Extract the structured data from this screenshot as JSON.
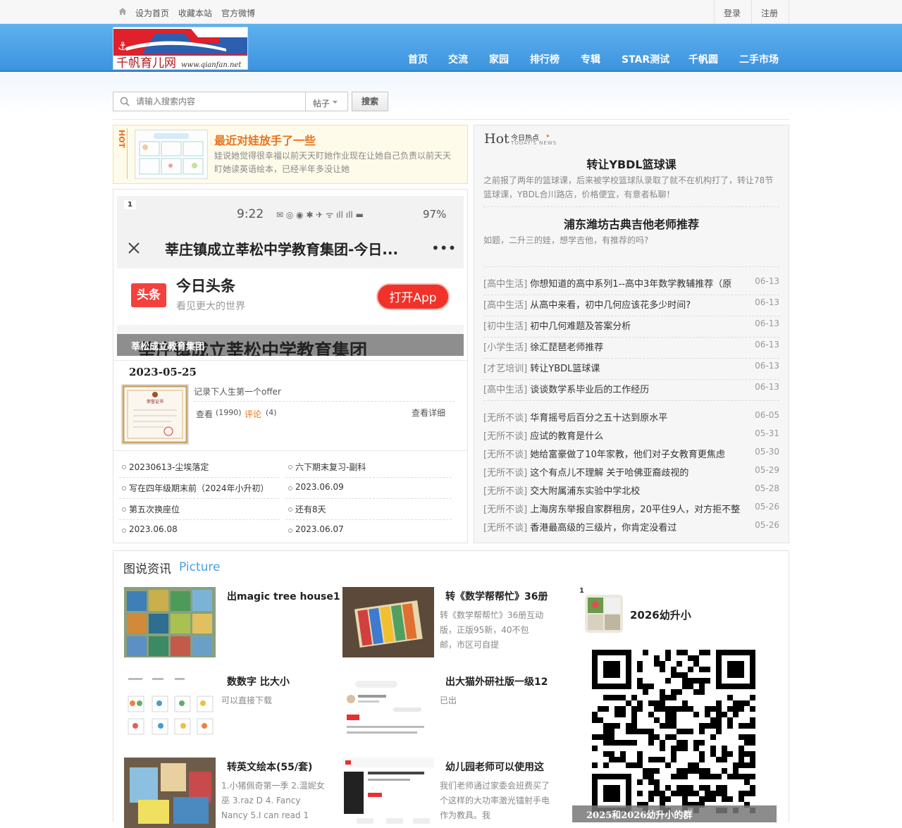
{
  "topbar": {
    "set_home": "设为首页",
    "bookmark": "收藏本站",
    "weibo": "官方微博",
    "login": "登录",
    "register": "注册"
  },
  "logo": {
    "text": "千帆育儿网",
    "url": "www.qianfan.net"
  },
  "nav": [
    "首页",
    "交流",
    "家园",
    "排行榜",
    "专辑",
    "STAR测试",
    "千帆圆",
    "二手市场"
  ],
  "search": {
    "placeholder": "请输入搜索内容",
    "type": "帖子",
    "button": "搜索"
  },
  "hot": {
    "badge": "HOT",
    "title": "最近对娃放手了一些",
    "desc": "娃说她觉得很幸福以前天天盯她作业现在让她自己负责以前天天盯她读英语绘本，已经半年多没让她"
  },
  "right": {
    "hot_logo": "Hot",
    "hot_label": "今日热点",
    "hot_sub": "TODAY'S NEWS",
    "headline1": "转让YBDL篮球课",
    "headline1_desc": "之前报了两年的篮球课，后来被学校篮球队录取了就不在机构打了，转让78节篮球课，YBDL合川路店，价格便宜，有意者私聊！",
    "headline2": "浦东潍坊古典吉他老师推荐",
    "headline2_desc": "如题，二升三的娃，想学吉他，有推荐的吗?",
    "list1": [
      {
        "cat": "[高中生活]",
        "title": "你想知道的高中系列1--高中3年数学教辅推荐（原",
        "date": "06-13"
      },
      {
        "cat": "[高中生活]",
        "title": "从高中来看，初中几何应该花多少时间?",
        "date": "06-13"
      },
      {
        "cat": "[初中生活]",
        "title": "初中几何难题及答案分析",
        "date": "06-13"
      },
      {
        "cat": "[小学生活]",
        "title": "徐汇琵琶老师推荐",
        "date": "06-13"
      },
      {
        "cat": "[才艺培训]",
        "title": "转让YBDL篮球课",
        "date": "06-13"
      },
      {
        "cat": "[高中生活]",
        "title": "谈谈数学系毕业后的工作经历",
        "date": "06-13"
      }
    ],
    "list2": [
      {
        "cat": "[无所不谈]",
        "title": "华育摇号后百分之五十达到原水平",
        "date": "06-05"
      },
      {
        "cat": "[无所不谈]",
        "title": "应试的教育是什么",
        "date": "05-31"
      },
      {
        "cat": "[无所不谈]",
        "title": "她给富豪做了10年家教，他们对子女教育更焦虑",
        "date": "05-30"
      },
      {
        "cat": "[无所不谈]",
        "title": "这个有点儿不理解 关于哈佛亚裔歧视的",
        "date": "05-29"
      },
      {
        "cat": "[无所不谈]",
        "title": "交大附属浦东实验中学北校",
        "date": "05-28"
      },
      {
        "cat": "[无所不谈]",
        "title": "上海房东举报自家群租房，20平住9人，对方拒不整",
        "date": "05-26"
      },
      {
        "cat": "[无所不谈]",
        "title": "香港最高级的三级片，你肯定没看过",
        "date": "05-26"
      }
    ]
  },
  "slide": {
    "index": "1",
    "phone_time": "9:22",
    "phone_battery": "97%",
    "page_title": "莘庄镇成立莘松中学教育集团-今日...",
    "app_name": "今日头条",
    "app_logo": "头条",
    "app_slogan": "看见更大的世界",
    "open_app": "打开App",
    "bg_text": "莘庄镇成立莘松中学教育集团",
    "caption": "莘松成立教育集团"
  },
  "post": {
    "date": "2023-05-25",
    "title": "记录下人生第一个offer",
    "views_label": "查看",
    "views": "(1990)",
    "comments_label": "评论",
    "comments": "(4)",
    "detail": "查看详细",
    "cert_title": "荣誉证书"
  },
  "left_list": [
    "20230613-尘埃落定",
    "六下期末复习-副科",
    "写在四年级期末前（2024年小升初）",
    "2023.06.09",
    "第五次换座位",
    "还有8天",
    "2023.06.08",
    "2023.06.07"
  ],
  "pic": {
    "title": "图说资讯",
    "title_en": "Picture",
    "items": [
      {
        "title": "出magic tree house1",
        "desc": ""
      },
      {
        "title": "转《数学帮帮忙》36册",
        "desc": "转《数学帮帮忙》36册互动版，正版95新，40不包邮，市区可自提"
      },
      {
        "title": "数数字 比大小",
        "desc": "可以直接下载"
      },
      {
        "title": "出大猫外研社版一级12",
        "desc": "已出"
      },
      {
        "title": "转英文绘本(55/套)",
        "desc": "1.小猪佩奇第一季 2.温妮女巫 3.raz D 4. Fancy Nancy 5.I can read 1"
      },
      {
        "title": "幼儿园老师可以使用这",
        "desc": "我们老师通过家委会班费买了个这样的大功率激光镭射手电作为教具。我"
      }
    ],
    "side_index": "1",
    "side_title": "2026幼升小",
    "side_caption": "2025和2026幼升小的群"
  },
  "colors": {
    "nav_bg": "#4ea2e6",
    "accent": "#f5a623",
    "hot_title": "#e8731e"
  }
}
